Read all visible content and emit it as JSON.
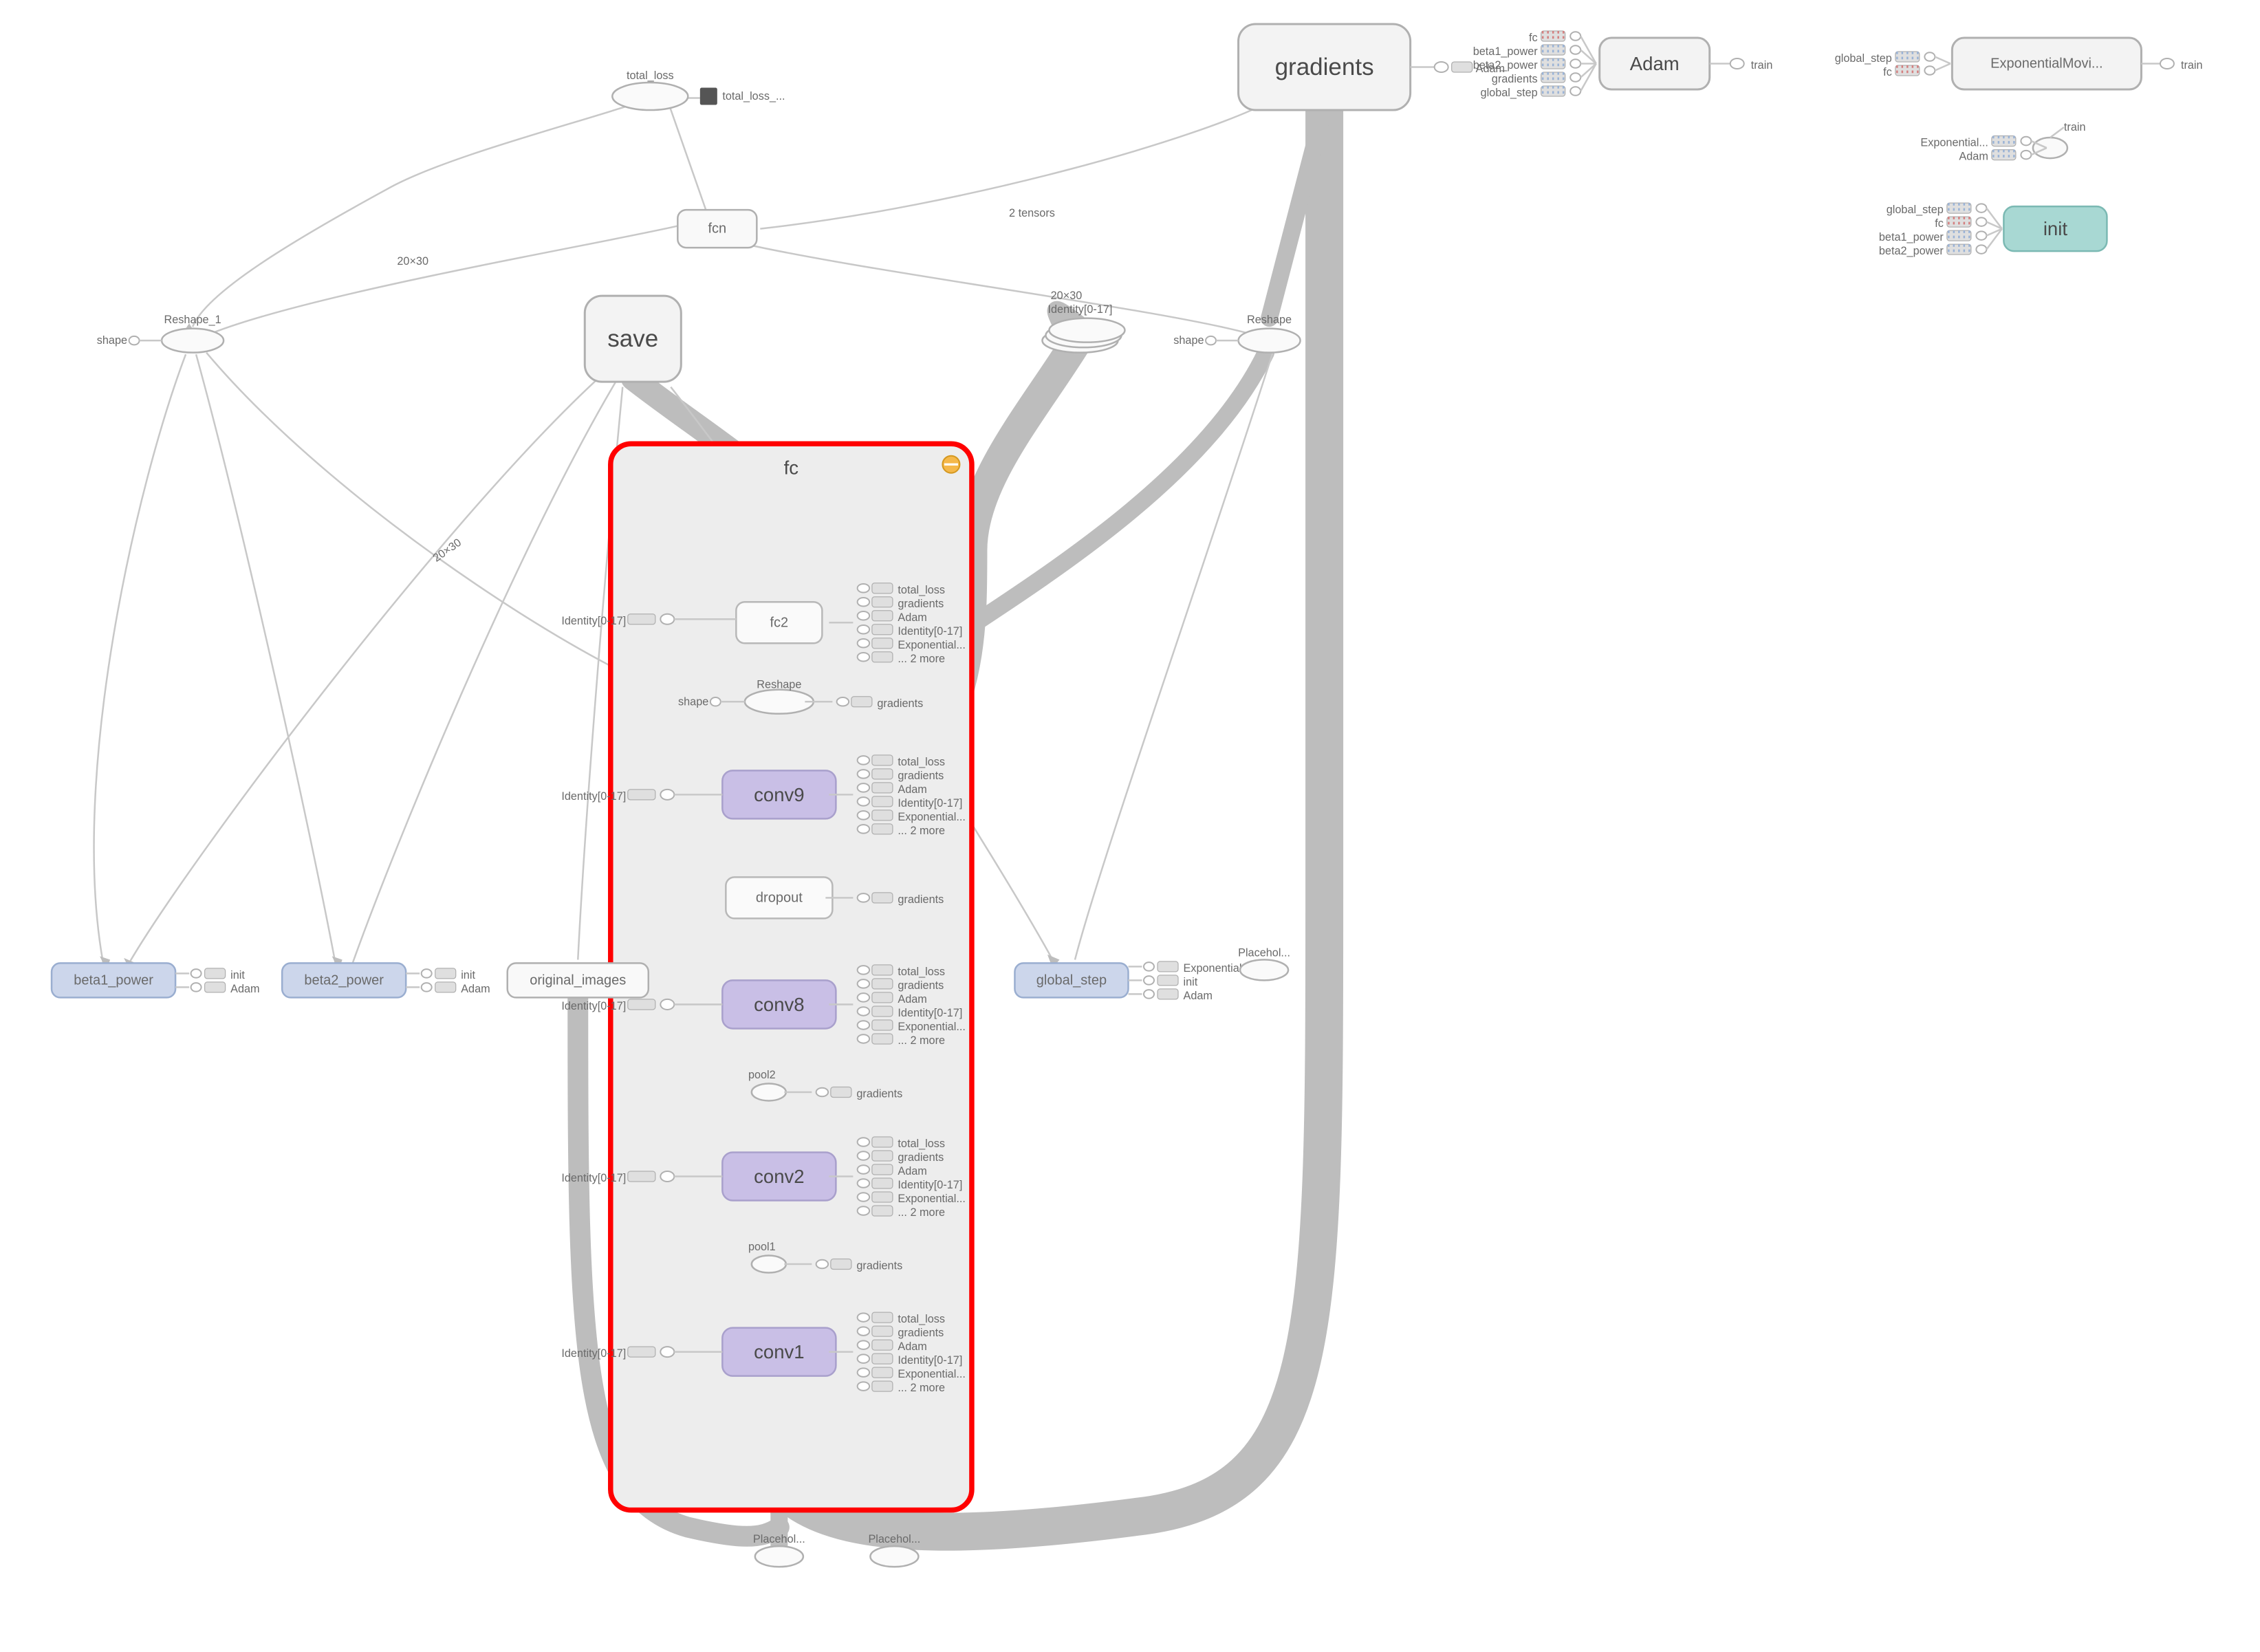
{
  "nodes": {
    "gradients": "gradients",
    "adam": "Adam",
    "expmov": "ExponentialMovi...",
    "init": "init",
    "total_loss": "total_loss",
    "total_loss_s": "total_loss_...",
    "fcn": "fcn",
    "save": "save",
    "reshape1": "Reshape_1",
    "reshape1_shape": "shape",
    "identity017": "Identity[0-17]",
    "reshape": "Reshape",
    "reshape_shape": "shape",
    "beta1": "beta1_power",
    "beta2": "beta2_power",
    "original_images": "original_images",
    "global_step": "global_step",
    "placehol1": "Placehol...",
    "placehol2": "Placehol...",
    "placehol_right": "Placehol..."
  },
  "fc_group": {
    "title": "fc",
    "nodes": {
      "fc2": "fc2",
      "reshape": "Reshape",
      "reshape_shape": "shape",
      "conv9": "conv9",
      "dropout": "dropout",
      "conv8": "conv8",
      "conv2": "conv2",
      "conv1": "conv1",
      "pool2": "pool2",
      "pool1": "pool1"
    },
    "identity_in": "Identity[0-17]",
    "outputs_major": [
      "total_loss",
      "gradients",
      "Adam",
      "Identity[0-17]",
      "Exponential...",
      "... 2 more"
    ],
    "outputs_gradients": "gradients"
  },
  "right_top": {
    "adam_inputs": [
      "fc",
      "beta1_power",
      "beta2_power",
      "gradients",
      "global_step"
    ],
    "adam_out": "train",
    "expmov_inputs": [
      "global_step",
      "fc"
    ],
    "expmov_out": "train",
    "small_group_inputs": [
      "Exponential...",
      "Adam"
    ],
    "small_group_out": "train",
    "init_inputs": [
      "global_step",
      "fc",
      "beta1_power",
      "beta2_power"
    ]
  },
  "global_step_rights": [
    "Exponential...",
    "init",
    "Adam"
  ],
  "beta_rights": [
    "init",
    "Adam"
  ]
}
